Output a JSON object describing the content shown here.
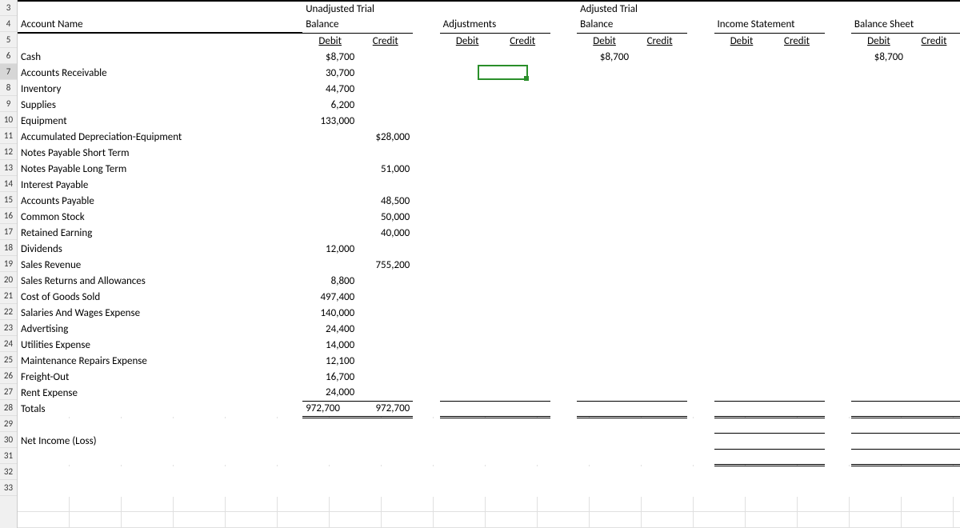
{
  "row_numbers_start": 3,
  "row_numbers_end": 33,
  "headers": {
    "account": "Account Name",
    "groups": [
      {
        "line1": "Unadjusted Trial",
        "line2": "Balance"
      },
      {
        "line1": "",
        "line2": "Adjustments"
      },
      {
        "line1": "Adjusted Trial",
        "line2": "Balance"
      },
      {
        "line1": "",
        "line2": "Income Statement"
      },
      {
        "line1": "",
        "line2": "Balance Sheet"
      }
    ],
    "debit": "Debit",
    "credit": "Credit"
  },
  "rows": [
    {
      "r": 6,
      "name": "Cash",
      "utb_d": "$8,700",
      "utb_c": "",
      "atb_d": "$8,700",
      "bs_d": "$8,700"
    },
    {
      "r": 7,
      "name": "Accounts Receivable",
      "utb_d": "30,700",
      "utb_c": ""
    },
    {
      "r": 8,
      "name": "Inventory",
      "utb_d": "44,700",
      "utb_c": ""
    },
    {
      "r": 9,
      "name": "Supplies",
      "utb_d": "6,200",
      "utb_c": ""
    },
    {
      "r": 10,
      "name": "Equipment",
      "utb_d": "133,000",
      "utb_c": ""
    },
    {
      "r": 11,
      "name": "Accumulated Depreciation-Equipment",
      "utb_d": "",
      "utb_c": "$28,000"
    },
    {
      "r": 12,
      "name": "Notes Payable Short Term",
      "utb_d": "",
      "utb_c": ""
    },
    {
      "r": 13,
      "name": "Notes Payable Long Term",
      "utb_d": "",
      "utb_c": "51,000"
    },
    {
      "r": 14,
      "name": "Interest Payable",
      "utb_d": "",
      "utb_c": ""
    },
    {
      "r": 15,
      "name": "Accounts Payable",
      "utb_d": "",
      "utb_c": "48,500"
    },
    {
      "r": 16,
      "name": "Common Stock",
      "utb_d": "",
      "utb_c": "50,000"
    },
    {
      "r": 17,
      "name": "Retained Earning",
      "utb_d": "",
      "utb_c": "40,000"
    },
    {
      "r": 18,
      "name": "Dividends",
      "utb_d": "12,000",
      "utb_c": ""
    },
    {
      "r": 19,
      "name": "Sales Revenue",
      "utb_d": "",
      "utb_c": "755,200"
    },
    {
      "r": 20,
      "name": "Sales Returns and Allowances",
      "utb_d": "8,800",
      "utb_c": ""
    },
    {
      "r": 21,
      "name": "Cost of Goods Sold",
      "utb_d": "497,400",
      "utb_c": ""
    },
    {
      "r": 22,
      "name": "Salaries And Wages Expense",
      "utb_d": "140,000",
      "utb_c": ""
    },
    {
      "r": 23,
      "name": "Advertising",
      "utb_d": "24,400",
      "utb_c": ""
    },
    {
      "r": 24,
      "name": "Utilities Expense",
      "utb_d": "14,000",
      "utb_c": ""
    },
    {
      "r": 25,
      "name": "Maintenance Repairs Expense",
      "utb_d": "12,100",
      "utb_c": ""
    },
    {
      "r": 26,
      "name": "Freight-Out",
      "utb_d": "16,700",
      "utb_c": ""
    },
    {
      "r": 27,
      "name": "Rent Expense",
      "utb_d": "24,000",
      "utb_c": ""
    }
  ],
  "totals": {
    "label": "Totals",
    "utb_d": "972,700",
    "utb_c": "972,700"
  },
  "net_income_label": "Net Income (Loss)",
  "selected_row": 7
}
